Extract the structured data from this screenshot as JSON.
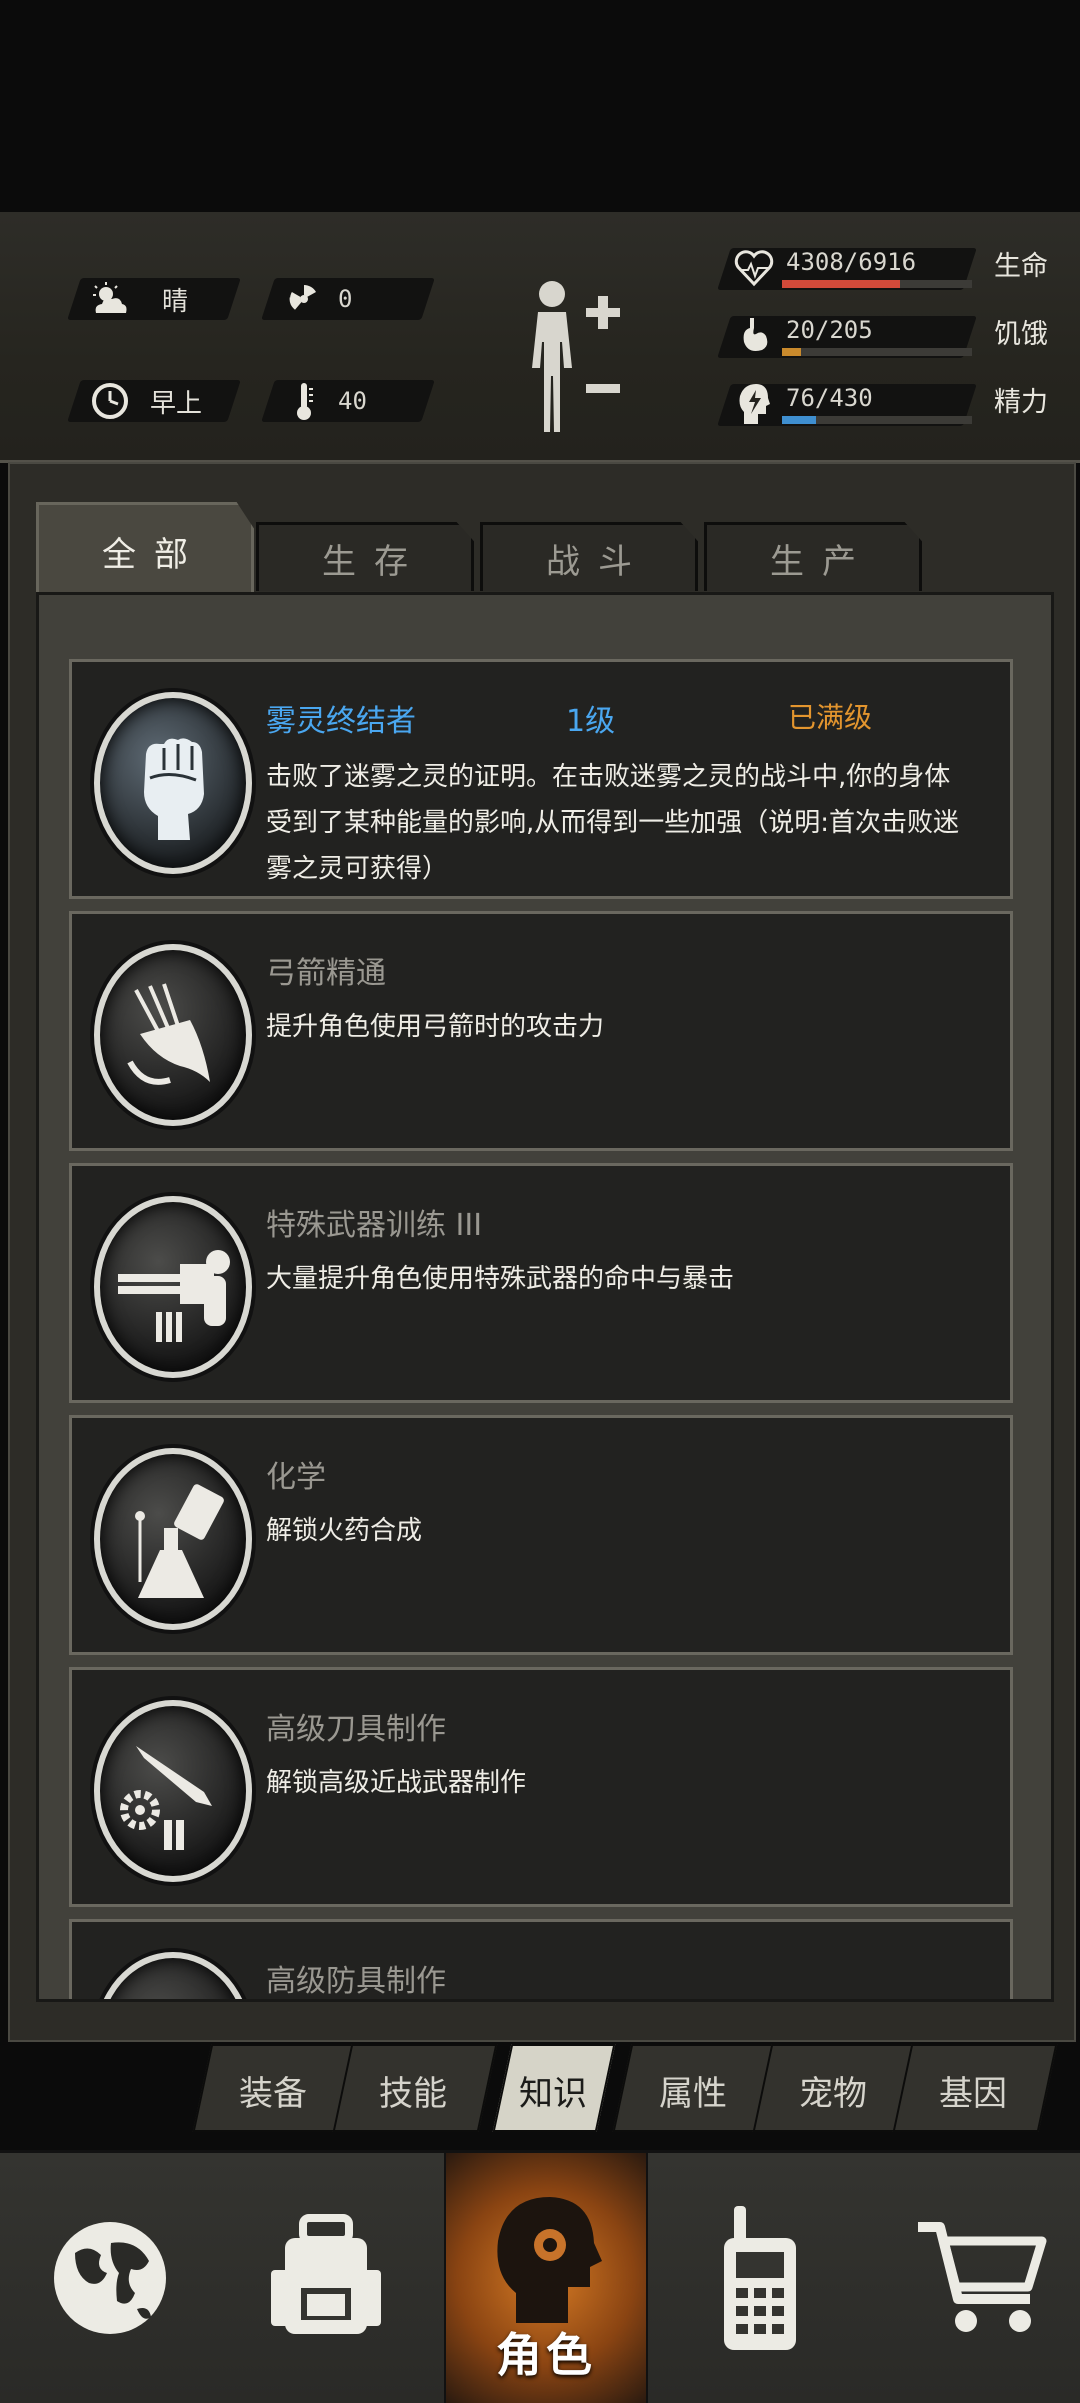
{
  "status": {
    "weather": "晴",
    "radiation": "0",
    "time_of_day": "早上",
    "temperature": "40",
    "health": {
      "text": "4308/6916",
      "label": "生命",
      "fraction": 0.62,
      "color": "#d24a3a"
    },
    "hunger": {
      "text": "20/205",
      "label": "饥饿",
      "fraction": 0.1,
      "color": "#c98a2c"
    },
    "energy": {
      "text": "76/430",
      "label": "精力",
      "fraction": 0.18,
      "color": "#3f8fd0"
    }
  },
  "tabs": [
    "全部",
    "生存",
    "战斗",
    "生产"
  ],
  "active_tab": "全部",
  "knowledge": [
    {
      "name": "雾灵终结者",
      "level": "1级",
      "status": "已满级",
      "highlight": true,
      "desc": "击败了迷雾之灵的证明。在击败迷雾之灵的战斗中,你的身体受到了某种能量的影响,从而得到一些加强（说明:首次击败迷雾之灵可获得）",
      "icon": "fist-icon"
    },
    {
      "name": "弓箭精通",
      "desc": "提升角色使用弓箭时的攻击力",
      "icon": "arrows-quiver-icon"
    },
    {
      "name": "特殊武器训练 III",
      "desc": "大量提升角色使用特殊武器的命中与暴击",
      "icon": "gatling-gun-icon"
    },
    {
      "name": "化学",
      "desc": "解锁火药合成",
      "icon": "flask-icon"
    },
    {
      "name": "高级刀具制作",
      "desc": "解锁高级近战武器制作",
      "icon": "knife-gear-icon"
    },
    {
      "name": "高级防具制作",
      "desc": "",
      "icon": "armor-icon"
    }
  ],
  "subtabs": [
    "装备",
    "技能",
    "知识",
    "属性",
    "宠物",
    "基因"
  ],
  "active_subtab": "知识",
  "nav": [
    {
      "label": "",
      "icon": "globe-icon"
    },
    {
      "label": "",
      "icon": "backpack-icon"
    },
    {
      "label": "角色",
      "icon": "head-gear-icon",
      "active": true
    },
    {
      "label": "",
      "icon": "radio-icon"
    },
    {
      "label": "",
      "icon": "shopping-cart-icon"
    }
  ]
}
